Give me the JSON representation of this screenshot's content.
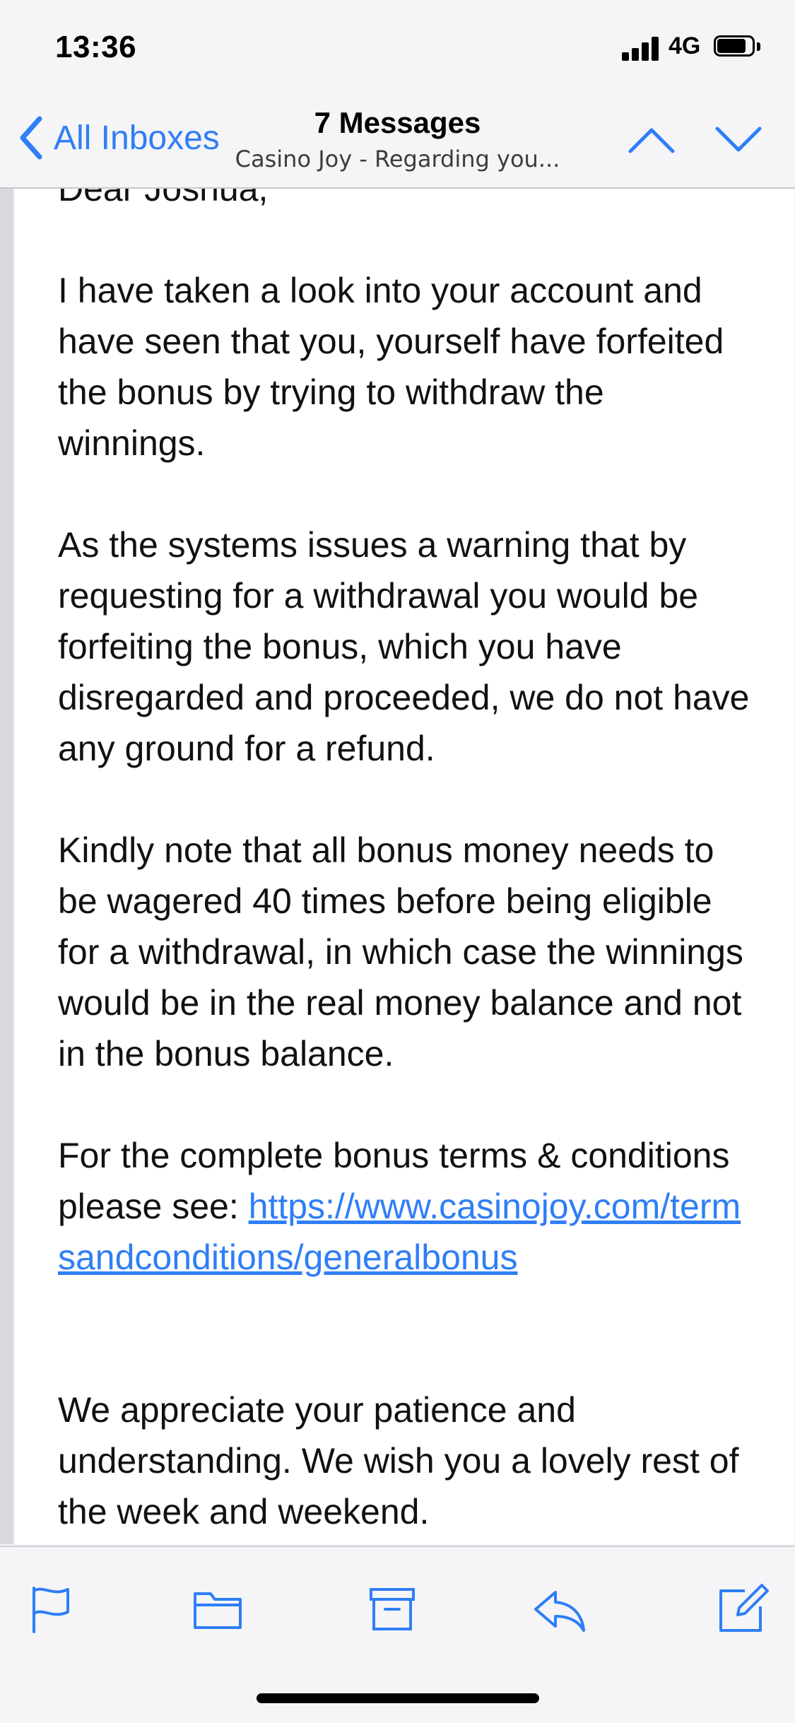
{
  "status_bar": {
    "time": "13:36",
    "network": "4G"
  },
  "nav": {
    "back_label": "All Inboxes",
    "title": "7 Messages",
    "subtitle": "Casino Joy - Regarding you..."
  },
  "message": {
    "greeting": "Dear Joshua,",
    "paragraphs": [
      "I have taken a look into your account and have seen that you, yourself have forfeited the bonus by trying to withdraw the winnings.",
      "As the systems issues a warning that by requesting for a withdrawal you would be forfeiting the bonus, which you have disregarded and proceeded, we do not have any ground for a refund.",
      "Kindly note that all bonus money needs to be wagered 40 times before being eligible for a withdrawal, in which case the winnings would be in the real money balance and not in the bonus balance."
    ],
    "terms_prefix": "For the complete bonus terms & conditions please see: ",
    "terms_link": "https://www.casinojoy.com/termsandconditions/generalbonus",
    "closing": "We appreciate your patience and understanding. We wish you a lovely rest of the week and weekend."
  },
  "toolbar": {
    "icons": [
      "flag-icon",
      "folder-icon",
      "archive-icon",
      "reply-icon",
      "compose-icon"
    ]
  },
  "colors": {
    "accent": "#2f7ef6",
    "bar_background": "#f5f5f7"
  }
}
